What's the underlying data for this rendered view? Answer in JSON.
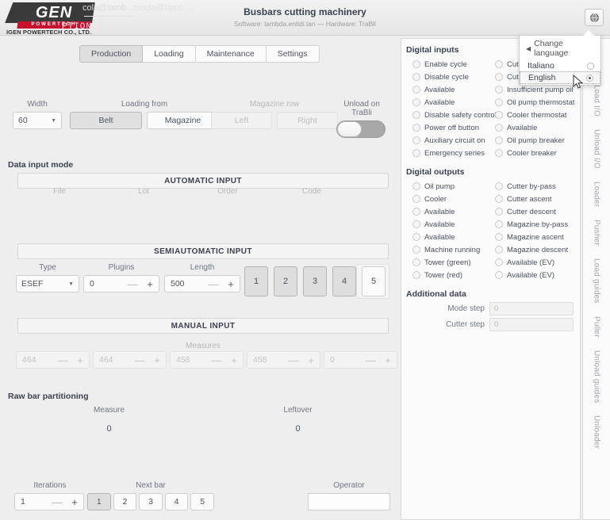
{
  "header": {
    "logo_main": "GEN",
    "logo_bar": "POWERTECH",
    "logo_sub": "IGEN POWERTECH CO., LTD.",
    "ghost_1": "cola@lamb…",
    "ghost_2": "nicola@lamb…",
    "ghost_3": "PTION…]",
    "title": "Busbars cutting machinery",
    "subtitle": "Software: lambda.entidi.lan — Hardware: TraBli",
    "lang_icon": "globe-icon"
  },
  "language_popover": {
    "back_arrow": "◀",
    "heading": "Change language",
    "options": [
      {
        "label": "Italiano",
        "selected": false
      },
      {
        "label": "English",
        "selected": true
      }
    ]
  },
  "tabs": [
    {
      "label": "Production",
      "active": true
    },
    {
      "label": "Loading",
      "active": false
    },
    {
      "label": "Maintenance",
      "active": false
    },
    {
      "label": "Settings",
      "active": false
    }
  ],
  "top_controls": {
    "width": {
      "label": "Width",
      "value": "60",
      "caret": "▼"
    },
    "loading_from": {
      "label": "Loading from",
      "buttons": [
        {
          "label": "Belt",
          "active": true
        },
        {
          "label": "Magazine",
          "active": false
        }
      ]
    },
    "magazine_row": {
      "label": "Magazine row",
      "buttons": [
        {
          "label": "Left",
          "disabled": true
        },
        {
          "label": "Right",
          "disabled": true
        }
      ]
    },
    "unload": {
      "label": "Unload on TraBli",
      "on": false
    }
  },
  "data_input_mode": {
    "section_label": "Data input mode",
    "automatic": {
      "band": "AUTOMATIC INPUT",
      "fields": [
        "File",
        "Lot",
        "Order",
        "Code"
      ],
      "doc_icon": "document-icon"
    },
    "semiautomatic": {
      "band": "SEMIAUTOMATIC INPUT",
      "type": {
        "label": "Type",
        "value": "ESEF",
        "caret": "▼"
      },
      "plugins": {
        "label": "Plugins",
        "value": "0",
        "minus": "—",
        "plus": "+"
      },
      "length": {
        "label": "Length",
        "value": "500",
        "minus": "—",
        "plus": "+"
      },
      "bar_buttons": [
        {
          "label": "1",
          "active": true
        },
        {
          "label": "2",
          "active": true
        },
        {
          "label": "3",
          "active": true
        },
        {
          "label": "4",
          "active": true
        },
        {
          "label": "5",
          "active": false
        }
      ]
    },
    "manual": {
      "band": "MANUAL INPUT",
      "measures_label": "Measures",
      "measures": [
        {
          "value": "464",
          "minus": "—",
          "plus": "+"
        },
        {
          "value": "464",
          "minus": "—",
          "plus": "+"
        },
        {
          "value": "458",
          "minus": "—",
          "plus": "+"
        },
        {
          "value": "458",
          "minus": "—",
          "plus": "+"
        },
        {
          "value": "0",
          "minus": "—",
          "plus": "+"
        }
      ]
    }
  },
  "raw_bar": {
    "section_label": "Raw bar partitioning",
    "measure": {
      "label": "Measure",
      "value": "0"
    },
    "leftover": {
      "label": "Leftover",
      "value": "0"
    }
  },
  "bottom": {
    "iterations": {
      "label": "Iterations",
      "value": "1",
      "minus": "—",
      "plus": "+"
    },
    "next_bar": {
      "label": "Next bar",
      "buttons": [
        {
          "label": "1",
          "active": true
        },
        {
          "label": "2",
          "active": false
        },
        {
          "label": "3",
          "active": false
        },
        {
          "label": "4",
          "active": false
        },
        {
          "label": "5",
          "active": false
        }
      ]
    },
    "operator": {
      "label": "Operator",
      "value": "",
      "placeholder": ""
    }
  },
  "digital_inputs": {
    "title": "Digital inputs",
    "left": [
      "Enable cycle",
      "Disable cycle",
      "Available",
      "Available",
      "Disable safety controls",
      "Power off button",
      "Auxiliary circuit on",
      "Emergency series"
    ],
    "right": [
      "Cut…",
      "Cut…",
      "Insufficient pump oil",
      "Oil pump thermostat",
      "Cooler thermostat",
      "Available",
      "Oil pump breaker",
      "Cooler breaker"
    ]
  },
  "digital_outputs": {
    "title": "Digital outputs",
    "left": [
      "Oil pump",
      "Cooler",
      "Available",
      "Available",
      "Available",
      "Machine running",
      "Tower (green)",
      "Tower (red)"
    ],
    "right": [
      "Cutter by-pass",
      "Cutter ascent",
      "Cutter descent",
      "Magazine by-pass",
      "Magazine ascent",
      "Magazine descent",
      "Available (EV)",
      "Available (EV)"
    ]
  },
  "additional_data": {
    "title": "Additional data",
    "rows": [
      {
        "label": "Mode step",
        "value": "0"
      },
      {
        "label": "Cutter step",
        "value": "0"
      }
    ]
  },
  "side_tabs": [
    "Load I/O",
    "Unload I/O",
    "Loader",
    "Pusher",
    "Load guides",
    "Puller",
    "Unload guides",
    "Unloader"
  ]
}
